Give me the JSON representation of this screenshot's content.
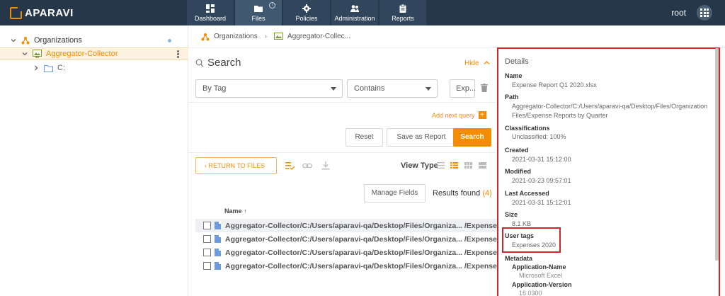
{
  "app": {
    "brand": "APARAVI",
    "user": "root"
  },
  "nav": {
    "tabs": [
      {
        "label": "Dashboard"
      },
      {
        "label": "Files"
      },
      {
        "label": "Policies"
      },
      {
        "label": "Administration"
      },
      {
        "label": "Reports"
      }
    ],
    "files_badge": "i"
  },
  "tree": {
    "root": "Organizations",
    "collector": "Aggregator-Collector",
    "drive": "C:"
  },
  "breadcrumb": {
    "root": "Organizations",
    "current": "Aggregator-Collec..."
  },
  "search": {
    "title": "Search",
    "hide": "Hide",
    "field": "By Tag",
    "operator": "Contains",
    "value": "Exp...",
    "add_query": "Add next query",
    "reset": "Reset",
    "save_report": "Save as Report",
    "search": "Search"
  },
  "toolbar": {
    "return": "RETURN TO FILES",
    "view_type": "View Type"
  },
  "results": {
    "manage_fields": "Manage Fields",
    "label": "Results found",
    "count": "(4)",
    "name_header": "Name",
    "rows": [
      "Aggregator-Collector/C:/Users/aparavi-qa/Desktop/Files/Organiza... /Expense Repor",
      "Aggregator-Collector/C:/Users/aparavi-qa/Desktop/Files/Organiza... /Expense Repo",
      "Aggregator-Collector/C:/Users/aparavi-qa/Desktop/Files/Organiza... /Expense Repo",
      "Aggregator-Collector/C:/Users/aparavi-qa/Desktop/Files/Organiza... /Expense Repo"
    ]
  },
  "details": {
    "title": "Details",
    "name_label": "Name",
    "name": "Expense Report Q1 2020.xlsx",
    "path_label": "Path",
    "path": "Aggregator-Collector/C:/Users/aparavi-qa/Desktop/Files/Organization Files/Expense Reports by Quarter",
    "classifications_label": "Classifications",
    "classifications": "Unclassified: 100%",
    "created_label": "Created",
    "created": "2021-03-31 15:12:00",
    "modified_label": "Modified",
    "modified": "2021-03-23 09:57:01",
    "accessed_label": "Last Accessed",
    "accessed": "2021-03-31 15:12:01",
    "size_label": "Size",
    "size": "8.1 KB",
    "tags_label": "User tags",
    "tags": "Expenses 2020",
    "metadata_label": "Metadata",
    "app_name_label": "Application-Name",
    "app_name": "Microsoft Excel",
    "app_version_label": "Application-Version",
    "app_version": "16.0300"
  },
  "colors": {
    "accent": "#f28c00",
    "topbar": "#26374a",
    "highlight_border": "#d0262c"
  }
}
